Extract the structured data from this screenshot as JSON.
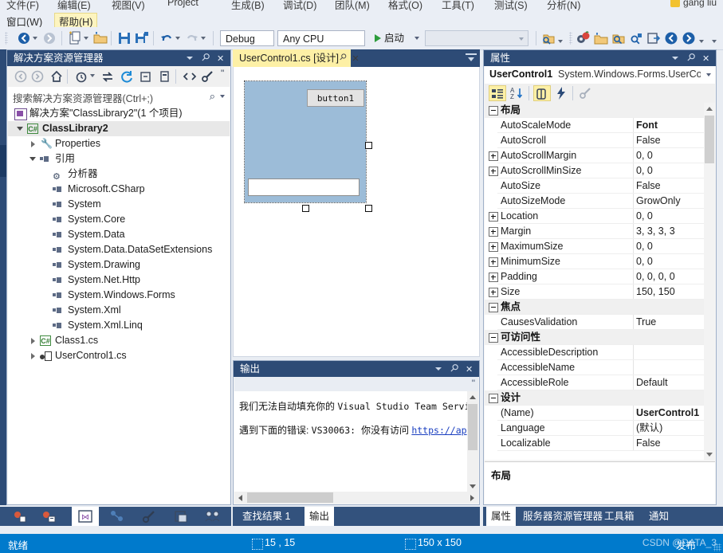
{
  "menu": {
    "row1": [
      "文件(F)",
      "编辑(E)",
      "视图(V)",
      "Project",
      "生成(B)",
      "调试(D)",
      "团队(M)",
      "格式(O)",
      "工具(T)",
      "测试(S)",
      "分析(N)"
    ],
    "row2": [
      "窗口(W)",
      "帮助(H)"
    ],
    "account": "gang liu"
  },
  "toolbar": {
    "back_icon": "navigate-back-icon",
    "forward_icon": "navigate-forward-icon",
    "new_item_icon": "new-item-icon",
    "open_icon": "open-folder-icon",
    "save_icon": "save-icon",
    "save_all_icon": "save-all-icon",
    "undo_icon": "undo-icon",
    "redo_icon": "redo-icon",
    "config_value": "Debug",
    "platform_value": "Any CPU",
    "start_label": "启动",
    "find_placeholder": "",
    "right_icons": [
      "find-in-files-icon",
      "settings-icon",
      "open-file-icon",
      "zoom-in-icon",
      "zoom-out-icon",
      "navigate-to-icon",
      "nav-back-icon",
      "nav-forward-icon"
    ]
  },
  "solution_explorer": {
    "title": "解决方案资源管理器",
    "toolbar_icons": [
      "back-icon",
      "forward-icon",
      "home-icon",
      "pending-changes-icon",
      "sync-icon",
      "refresh-icon",
      "collapse-all-icon",
      "properties-page-icon",
      "show-all-files-icon",
      "properties-icon",
      "overflow-icon"
    ],
    "search_placeholder": "搜索解决方案资源管理器(Ctrl+;)",
    "search_icon": "search-icon",
    "tree": [
      {
        "label": "解决方案\"ClassLibrary2\"(1 个项目)",
        "indent": 0,
        "expander": "none",
        "icon": "solution-icon",
        "bold": false,
        "selected": false
      },
      {
        "label": "ClassLibrary2",
        "indent": 1,
        "expander": "expanded",
        "icon": "csharp-project-icon",
        "bold": true,
        "selected": true
      },
      {
        "label": "Properties",
        "indent": 2,
        "expander": "collapsed",
        "icon": "wrench-icon",
        "bold": false,
        "selected": false
      },
      {
        "label": "引用",
        "indent": 2,
        "expander": "expanded",
        "icon": "references-icon",
        "bold": false,
        "selected": false
      },
      {
        "label": "分析器",
        "indent": 3,
        "expander": "none",
        "icon": "analyzer-icon",
        "bold": false,
        "selected": false
      },
      {
        "label": "Microsoft.CSharp",
        "indent": 3,
        "expander": "none",
        "icon": "reference-icon",
        "bold": false,
        "selected": false
      },
      {
        "label": "System",
        "indent": 3,
        "expander": "none",
        "icon": "reference-icon",
        "bold": false,
        "selected": false
      },
      {
        "label": "System.Core",
        "indent": 3,
        "expander": "none",
        "icon": "reference-icon",
        "bold": false,
        "selected": false
      },
      {
        "label": "System.Data",
        "indent": 3,
        "expander": "none",
        "icon": "reference-icon",
        "bold": false,
        "selected": false
      },
      {
        "label": "System.Data.DataSetExtensions",
        "indent": 3,
        "expander": "none",
        "icon": "reference-icon",
        "bold": false,
        "selected": false
      },
      {
        "label": "System.Drawing",
        "indent": 3,
        "expander": "none",
        "icon": "reference-icon",
        "bold": false,
        "selected": false
      },
      {
        "label": "System.Net.Http",
        "indent": 3,
        "expander": "none",
        "icon": "reference-icon",
        "bold": false,
        "selected": false
      },
      {
        "label": "System.Windows.Forms",
        "indent": 3,
        "expander": "none",
        "icon": "reference-icon",
        "bold": false,
        "selected": false
      },
      {
        "label": "System.Xml",
        "indent": 3,
        "expander": "none",
        "icon": "reference-icon",
        "bold": false,
        "selected": false
      },
      {
        "label": "System.Xml.Linq",
        "indent": 3,
        "expander": "none",
        "icon": "reference-icon",
        "bold": false,
        "selected": false
      },
      {
        "label": "Class1.cs",
        "indent": 2,
        "expander": "collapsed",
        "icon": "csharp-file-icon",
        "bold": false,
        "selected": false
      },
      {
        "label": "UserControl1.cs",
        "indent": 2,
        "expander": "collapsed",
        "icon": "usercontrol-icon",
        "bold": false,
        "selected": false
      }
    ]
  },
  "designer": {
    "tab_label": "UserControl1.cs [设计]",
    "pin_icon": "pin-icon",
    "close_icon": "close-icon",
    "tab_menu_icon": "tab-list-icon",
    "control": {
      "button_text": "button1",
      "surface_color": "#9cbcd8"
    }
  },
  "output": {
    "title": "输出",
    "lines": [
      {
        "cn1": "我们无法自动填充你的 ",
        "mono": "Visual Studio Team Servic",
        "cn2": ""
      },
      {
        "cn1": "遇到下面的错误: ",
        "mono": "VS30063: ",
        "cn2": "你没有访问 ",
        "link": "https://ap"
      }
    ]
  },
  "properties": {
    "title": "属性",
    "object_name": "UserControl1",
    "object_type": "System.Windows.Forms.UserCo",
    "toolbar_icons": [
      "categorized-icon",
      "alphabetical-icon",
      "properties-icon",
      "events-icon",
      "property-pages-icon"
    ],
    "rows": [
      {
        "kind": "category",
        "name": "布局",
        "value": "",
        "expander": "minus"
      },
      {
        "kind": "prop",
        "name": "AutoScaleMode",
        "value": "Font",
        "expander": "none",
        "bold": true
      },
      {
        "kind": "prop",
        "name": "AutoScroll",
        "value": "False",
        "expander": "none"
      },
      {
        "kind": "prop",
        "name": "AutoScrollMargin",
        "value": "0, 0",
        "expander": "plus"
      },
      {
        "kind": "prop",
        "name": "AutoScrollMinSize",
        "value": "0, 0",
        "expander": "plus"
      },
      {
        "kind": "prop",
        "name": "AutoSize",
        "value": "False",
        "expander": "none"
      },
      {
        "kind": "prop",
        "name": "AutoSizeMode",
        "value": "GrowOnly",
        "expander": "none"
      },
      {
        "kind": "prop",
        "name": "Location",
        "value": "0, 0",
        "expander": "plus"
      },
      {
        "kind": "prop",
        "name": "Margin",
        "value": "3, 3, 3, 3",
        "expander": "plus"
      },
      {
        "kind": "prop",
        "name": "MaximumSize",
        "value": "0, 0",
        "expander": "plus"
      },
      {
        "kind": "prop",
        "name": "MinimumSize",
        "value": "0, 0",
        "expander": "plus"
      },
      {
        "kind": "prop",
        "name": "Padding",
        "value": "0, 0, 0, 0",
        "expander": "plus"
      },
      {
        "kind": "prop",
        "name": "Size",
        "value": "150, 150",
        "expander": "plus"
      },
      {
        "kind": "category",
        "name": "焦点",
        "value": "",
        "expander": "minus"
      },
      {
        "kind": "prop",
        "name": "CausesValidation",
        "value": "True",
        "expander": "none"
      },
      {
        "kind": "category",
        "name": "可访问性",
        "value": "",
        "expander": "minus"
      },
      {
        "kind": "prop",
        "name": "AccessibleDescription",
        "value": "",
        "expander": "none"
      },
      {
        "kind": "prop",
        "name": "AccessibleName",
        "value": "",
        "expander": "none"
      },
      {
        "kind": "prop",
        "name": "AccessibleRole",
        "value": "Default",
        "expander": "none"
      },
      {
        "kind": "category",
        "name": "设计",
        "value": "",
        "expander": "minus"
      },
      {
        "kind": "prop",
        "name": "(Name)",
        "value": "UserControl1",
        "expander": "none",
        "bold": true
      },
      {
        "kind": "prop",
        "name": "Language",
        "value": "(默认)",
        "expander": "none"
      },
      {
        "kind": "prop",
        "name": "Localizable",
        "value": "False",
        "expander": "none"
      }
    ],
    "description_title": "布局"
  },
  "bottom_tabs_left": {
    "icons": [
      "team-explorer-icon",
      "class-view-icon",
      "solution-explorer-icon",
      "server-explorer-icon",
      "properties-icon",
      "resource-view-icon",
      "team-icon"
    ],
    "active_index": 2
  },
  "bottom_tabs_center": [
    {
      "label": "查找结果 1",
      "active": false
    },
    {
      "label": "输出",
      "active": true
    }
  ],
  "bottom_tabs_right": [
    {
      "label": "属性",
      "active": true
    },
    {
      "label": "服务器资源管理器",
      "active": false
    },
    {
      "label": "工具箱",
      "active": false
    },
    {
      "label": "通知",
      "active": false
    }
  ],
  "statusbar": {
    "status": "就绪",
    "position_icon": "position-icon",
    "position": "15 , 15",
    "size_icon": "size-icon",
    "size": "150 x 150",
    "publish": "发布",
    "watermark": "CSDN @DATA_3"
  },
  "colors": {
    "accent": "#007acc",
    "panel_title": "#2d4b76",
    "tab_active": "#fdf0a6",
    "designer_surface": "#9cbcd8"
  }
}
